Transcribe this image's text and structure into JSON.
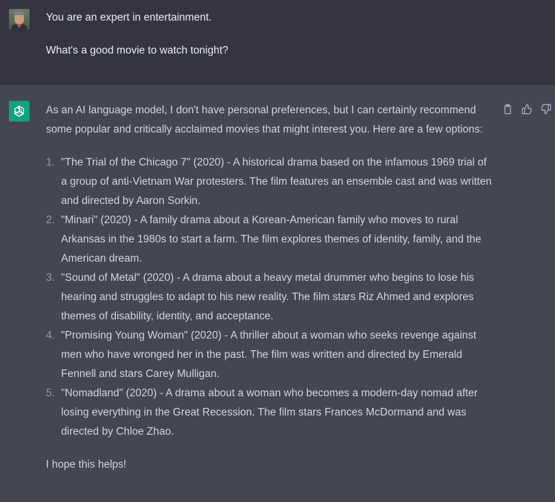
{
  "user_message": {
    "lines": [
      "You are an expert in entertainment.",
      "What's a good movie to watch tonight?"
    ]
  },
  "assistant_message": {
    "intro": "As an AI language model, I don't have personal preferences, but I can certainly recommend some popular and critically acclaimed movies that might interest you. Here are a few options:",
    "items": [
      {
        "num": "1.",
        "text": "\"The Trial of the Chicago 7\" (2020) - A historical drama based on the infamous 1969 trial of a group of anti-Vietnam War protesters. The film features an ensemble cast and was written and directed by Aaron Sorkin."
      },
      {
        "num": "2.",
        "text": "\"Minari\" (2020) - A family drama about a Korean-American family who moves to rural Arkansas in the 1980s to start a farm. The film explores themes of identity, family, and the American dream."
      },
      {
        "num": "3.",
        "text": "\"Sound of Metal\" (2020) - A drama about a heavy metal drummer who begins to lose his hearing and struggles to adapt to his new reality. The film stars Riz Ahmed and explores themes of disability, identity, and acceptance."
      },
      {
        "num": "4.",
        "text": "\"Promising Young Woman\" (2020) - A thriller about a woman who seeks revenge against men who have wronged her in the past. The film was written and directed by Emerald Fennell and stars Carey Mulligan."
      },
      {
        "num": "5.",
        "text": "\"Nomadland\" (2020) - A drama about a woman who becomes a modern-day nomad after losing everything in the Great Recession. The film stars Frances McDormand and was directed by Chloe Zhao."
      }
    ],
    "closing": "I hope this helps!"
  },
  "icons": {
    "copy": "clipboard-icon",
    "like": "thumbs-up-icon",
    "dislike": "thumbs-down-icon",
    "assistant_logo": "openai-logo-icon"
  },
  "colors": {
    "user_bg": "#343541",
    "assistant_bg": "#444654",
    "logo_bg": "#10a37f",
    "text": "#d1d5db"
  }
}
